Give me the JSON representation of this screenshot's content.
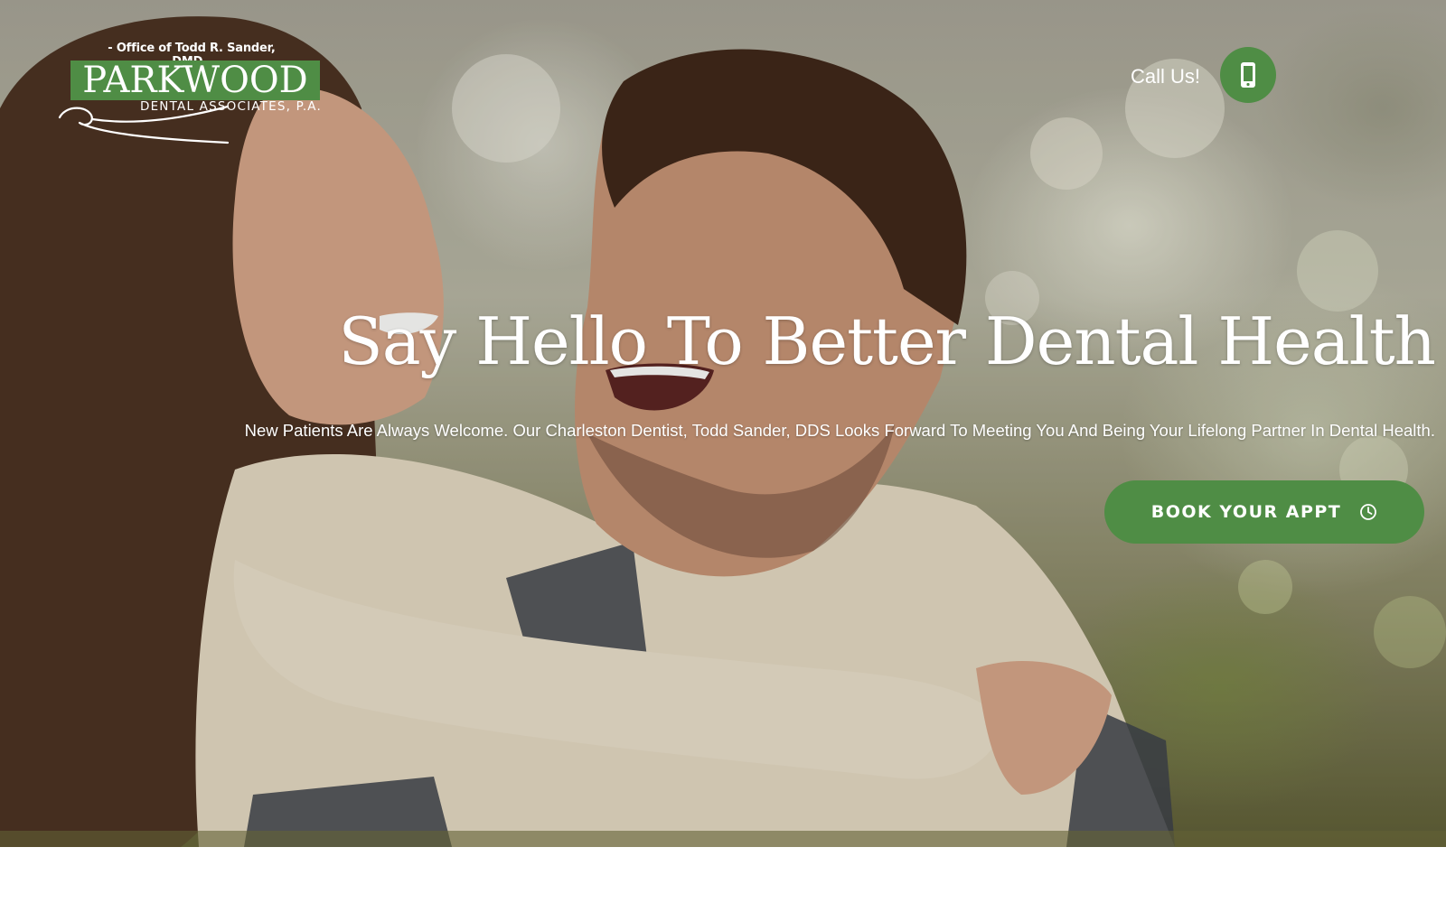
{
  "logo": {
    "tagline": "- Office of Todd R. Sander, DMD -",
    "name": "PARKWOOD",
    "subname": "DENTAL ASSOCIATES, P.A."
  },
  "header": {
    "call_label": "Call Us!",
    "call_icon": "mobile-phone-icon"
  },
  "hero": {
    "headline": "Say Hello To Better Dental Health",
    "subheadline": "New Patients Are Always Welcome. Our Charleston Dentist, Todd Sander, DDS Looks Forward To Meeting You And Being Your Lifelong Partner In Dental Health.",
    "cta_label": "BOOK YOUR APPT",
    "cta_icon": "clock-icon"
  },
  "colors": {
    "brand_green": "#4f8d45",
    "text_light": "#ffffff"
  }
}
